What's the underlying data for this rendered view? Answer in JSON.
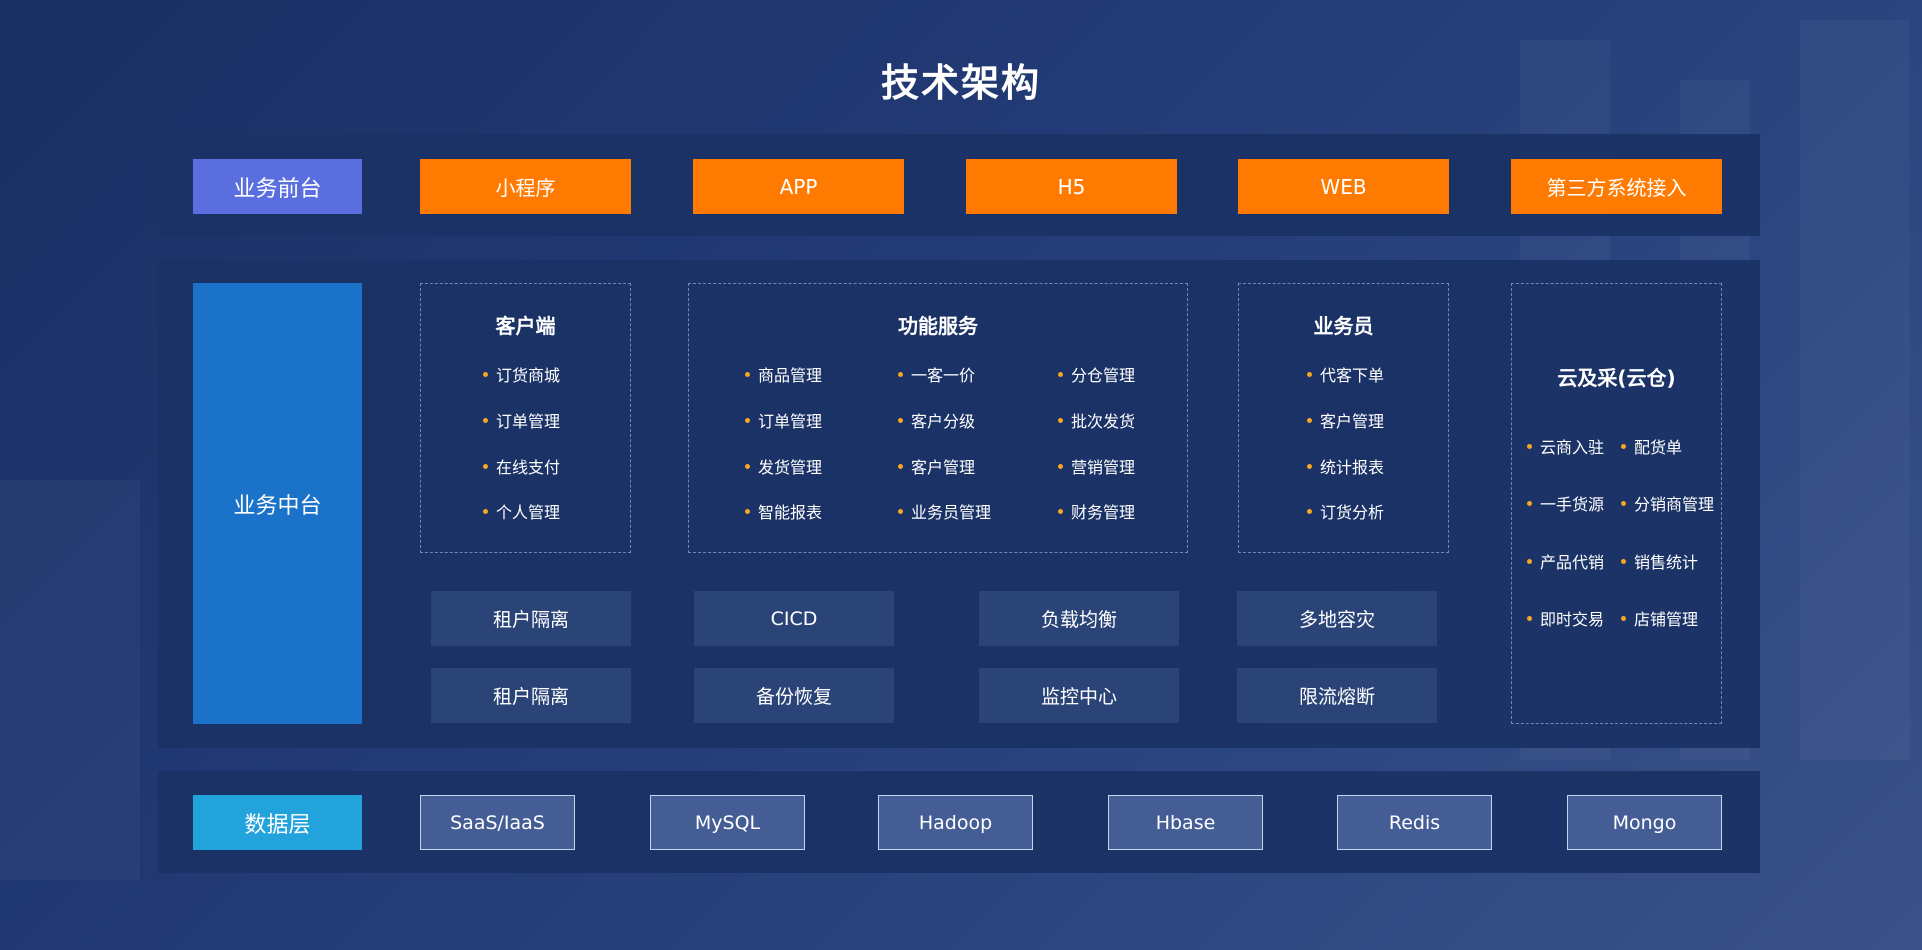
{
  "title": "技术架构",
  "front": {
    "label": "业务前台",
    "channels": [
      "小程序",
      "APP",
      "H5",
      "WEB",
      "第三方系统接入"
    ]
  },
  "middle": {
    "label": "业务中台",
    "client": {
      "title": "客户端",
      "items": [
        "订货商城",
        "订单管理",
        "在线支付",
        "个人管理"
      ]
    },
    "service": {
      "title": "功能服务",
      "columns": [
        [
          "商品管理",
          "订单管理",
          "发货管理",
          "智能报表"
        ],
        [
          "一客一价",
          "客户分级",
          "客户管理",
          "业务员管理"
        ],
        [
          "分仓管理",
          "批次发货",
          "营销管理",
          "财务管理"
        ]
      ]
    },
    "sales": {
      "title": "业务员",
      "items": [
        "代客下单",
        "客户管理",
        "统计报表",
        "订货分析"
      ]
    },
    "cloud": {
      "title": "云及采(云仓)",
      "left": [
        "云商入驻",
        "一手货源",
        "产品代销",
        "即时交易"
      ],
      "right": [
        "配货单",
        "分销商管理",
        "销售统计",
        "店铺管理"
      ]
    },
    "infra": [
      [
        "租户隔离",
        "CICD",
        "负载均衡",
        "多地容灾"
      ],
      [
        "租户隔离",
        "备份恢复",
        "监控中心",
        "限流熔断"
      ]
    ]
  },
  "data": {
    "label": "数据层",
    "items": [
      "SaaS/IaaS",
      "MySQL",
      "Hadoop",
      "Hbase",
      "Redis",
      "Mongo"
    ]
  },
  "colors": {
    "orange": "#ff7a00",
    "purple": "#5b6ee0",
    "blue": "#1a72c9",
    "cyan": "#23a3dc",
    "bullet": "#f5a623"
  }
}
